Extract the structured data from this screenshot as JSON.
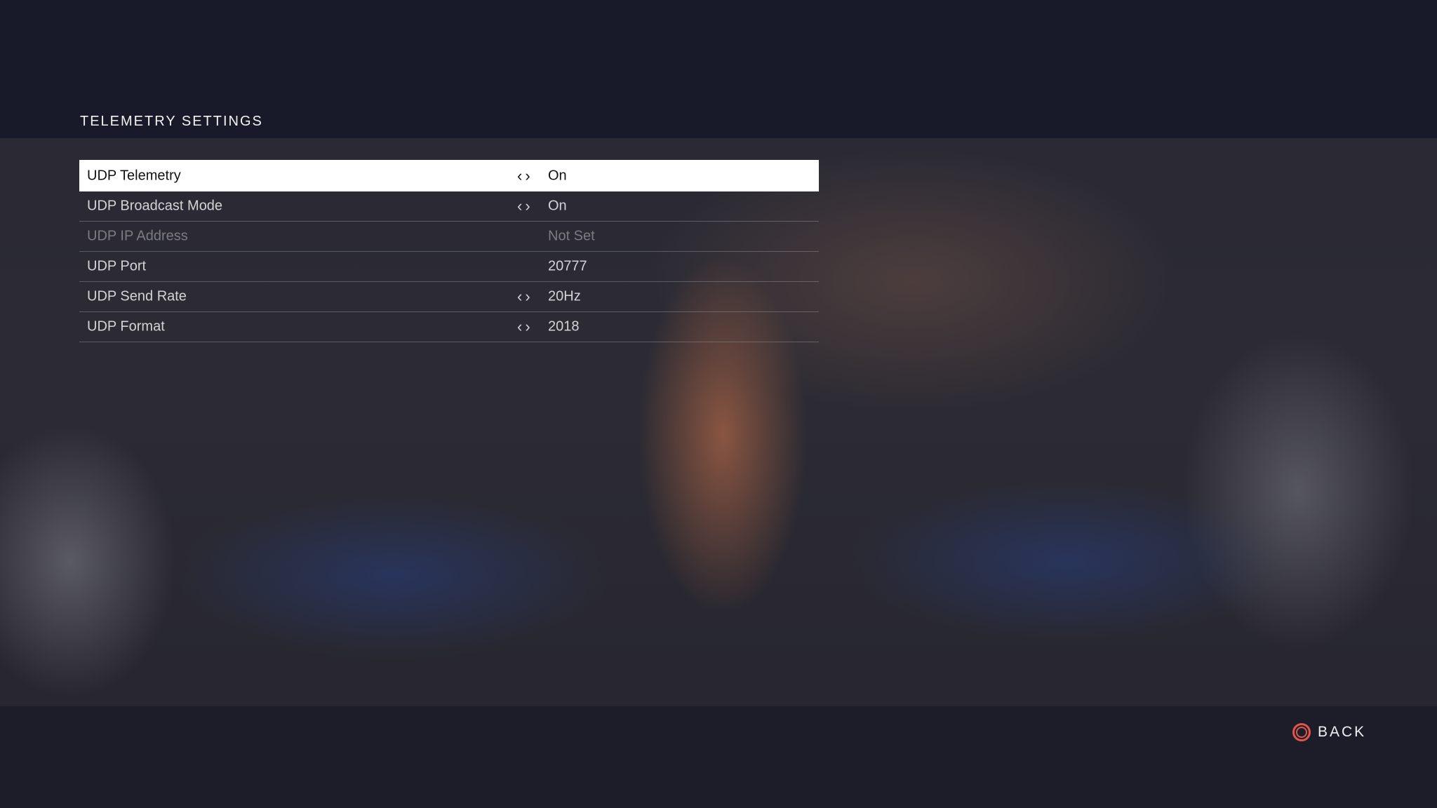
{
  "header": {
    "title": "TELEMETRY SETTINGS"
  },
  "settings": [
    {
      "label": "UDP Telemetry",
      "value": "On",
      "arrows": "‹›",
      "selected": true
    },
    {
      "label": "UDP Broadcast Mode",
      "value": "On",
      "arrows": "‹›"
    },
    {
      "label": "UDP IP Address",
      "value": "Not Set",
      "disabled": true
    },
    {
      "label": "UDP Port",
      "value": "20777"
    },
    {
      "label": "UDP Send Rate",
      "value": "20Hz",
      "arrows": "‹›"
    },
    {
      "label": "UDP Format",
      "value": "2018",
      "arrows": "‹›"
    }
  ],
  "footer": {
    "back_label": "BACK",
    "back_icon": "circle-button-icon",
    "accent": "#e0564a"
  }
}
